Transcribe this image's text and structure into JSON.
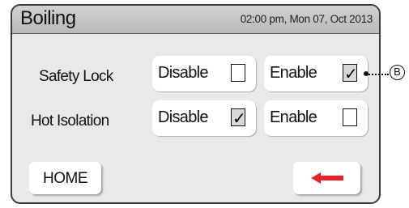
{
  "header": {
    "title": "Boiling",
    "datetime": "02:00 pm, Mon 07, Oct 2013"
  },
  "settings": [
    {
      "label": "Safety Lock",
      "disable": {
        "label": "Disable",
        "checked": false
      },
      "enable": {
        "label": "Enable",
        "checked": true
      }
    },
    {
      "label": "Hot Isolation",
      "disable": {
        "label": "Disable",
        "checked": true
      },
      "enable": {
        "label": "Enable",
        "checked": false
      }
    }
  ],
  "footer": {
    "home_label": "HOME",
    "back_icon": "left-arrow-icon",
    "back_color": "#e8202a"
  },
  "callout": {
    "letter": "B"
  },
  "colors": {
    "panel": "#e9e9e9",
    "titlebar": "#c4c4c4",
    "border": "#3a3a3a"
  }
}
